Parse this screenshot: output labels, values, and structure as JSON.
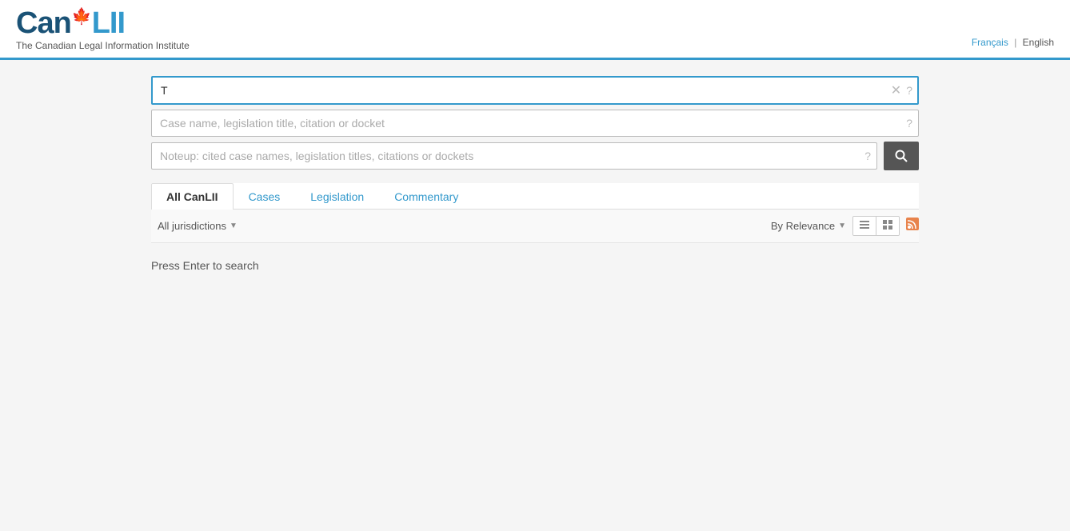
{
  "header": {
    "logo_can": "Can",
    "logo_lii": "LII",
    "tagline": "The Canadian Legal Information Institute",
    "lang_french": "Français",
    "lang_english": "English"
  },
  "search": {
    "main_value": "T|",
    "main_placeholder": "",
    "filter_placeholder": "Case name, legislation title, citation or docket",
    "noteup_placeholder": "Noteup: cited case names, legislation titles, citations or dockets"
  },
  "tabs": [
    {
      "id": "all-canlii",
      "label": "All CanLII",
      "active": true
    },
    {
      "id": "cases",
      "label": "Cases",
      "active": false
    },
    {
      "id": "legislation",
      "label": "Legislation",
      "active": false
    },
    {
      "id": "commentary",
      "label": "Commentary",
      "active": false
    }
  ],
  "filters": {
    "jurisdiction_label": "All jurisdictions",
    "sort_label": "By Relevance"
  },
  "search_button_icon": "🔍",
  "press_enter_message": "Press Enter to search",
  "rss_icon": "rss"
}
